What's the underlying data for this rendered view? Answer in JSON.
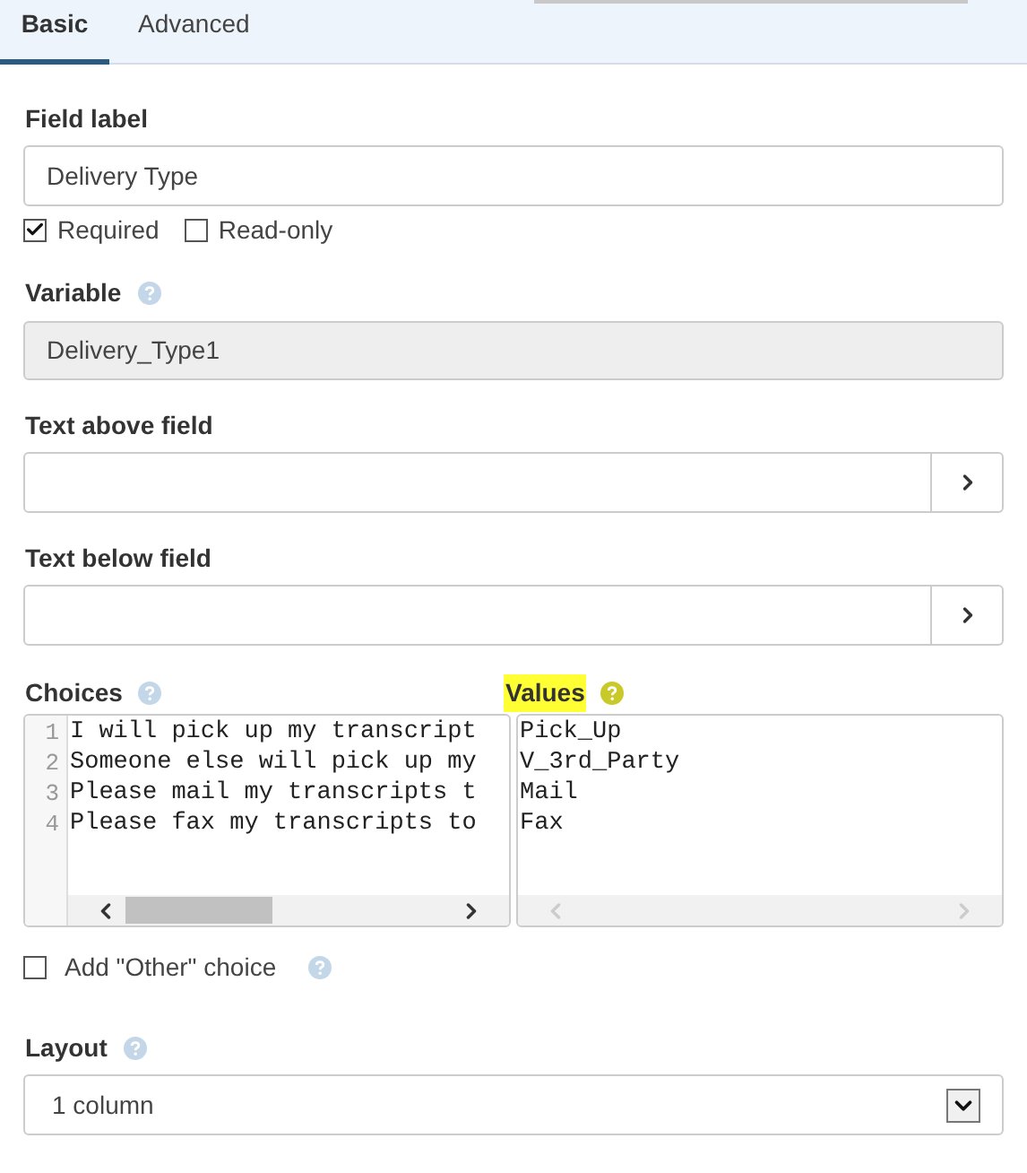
{
  "tabs": [
    {
      "label": "Basic",
      "selected": true
    },
    {
      "label": "Advanced",
      "selected": false
    }
  ],
  "field_label": {
    "label": "Field label",
    "value": "Delivery Type"
  },
  "options": [
    {
      "label": "Required",
      "checked": true
    },
    {
      "label": "Read-only",
      "checked": false
    }
  ],
  "variable": {
    "label": "Variable",
    "value": "Delivery_Type1",
    "disabled": true
  },
  "text_above": {
    "label": "Text above field"
  },
  "text_below": {
    "label": "Text below field"
  },
  "choices": {
    "label": "Choices",
    "line_numbers": [
      "1",
      "2",
      "3",
      "4"
    ],
    "lines": [
      "I will pick up my transcript",
      "Someone else will pick up my",
      "Please mail my transcripts t",
      "Please fax my transcripts to"
    ],
    "scroll_enabled": true
  },
  "values": {
    "label": "Values",
    "highlighted": true,
    "lines": [
      "Pick_Up",
      "V_3rd_Party",
      "Mail",
      "Fax"
    ],
    "scroll_enabled": false
  },
  "other_choice": {
    "label": "Add \"Other\" choice",
    "checked": false
  },
  "layout": {
    "label": "Layout",
    "value": "1 column"
  }
}
